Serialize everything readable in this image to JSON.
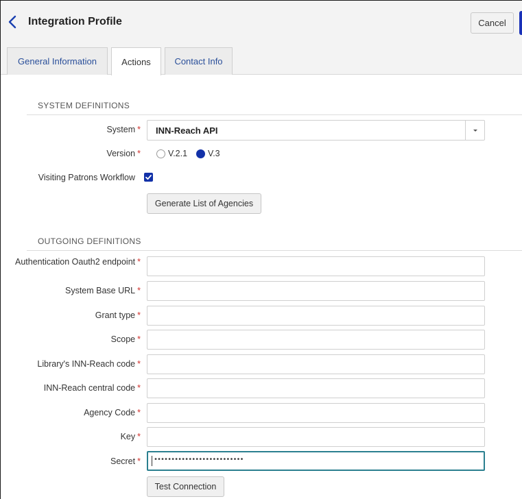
{
  "header": {
    "title": "Integration Profile",
    "cancel_label": "Cancel"
  },
  "tabs": [
    {
      "label": "General Information",
      "active": false
    },
    {
      "label": "Actions",
      "active": true
    },
    {
      "label": "Contact Info",
      "active": false
    }
  ],
  "system_definitions": {
    "title": "SYSTEM DEFINITIONS",
    "system": {
      "label": "System",
      "value": "INN-Reach API"
    },
    "version": {
      "label": "Version",
      "options": [
        "V.2.1",
        "V.3"
      ],
      "selected": "V.3"
    },
    "visiting_patrons": {
      "label": "Visiting Patrons Workflow",
      "checked": true
    },
    "generate_button": "Generate List of Agencies"
  },
  "outgoing_definitions": {
    "title": "OUTGOING DEFINITIONS",
    "fields": [
      {
        "label": "Authentication Oauth2 endpoint",
        "value": ""
      },
      {
        "label": "System Base URL",
        "value": ""
      },
      {
        "label": "Grant type",
        "value": ""
      },
      {
        "label": "Scope",
        "value": ""
      },
      {
        "label": "Library's INN-Reach code",
        "value": ""
      },
      {
        "label": "INN-Reach central code",
        "value": ""
      },
      {
        "label": "Agency Code",
        "value": ""
      },
      {
        "label": "Key",
        "value": ""
      },
      {
        "label": "Secret",
        "value": "••••••••••••••••••••••••••"
      }
    ],
    "test_button": "Test Connection"
  },
  "required_marker": "*",
  "colors": {
    "accent": "#1231a8",
    "required": "#d0312d",
    "focus": "#2a7f8f",
    "tab_link": "#2a4f9a"
  },
  "icons": {
    "back": "chevron-left-icon",
    "dropdown": "caret-down-icon",
    "checkbox": "checkmark-icon"
  }
}
